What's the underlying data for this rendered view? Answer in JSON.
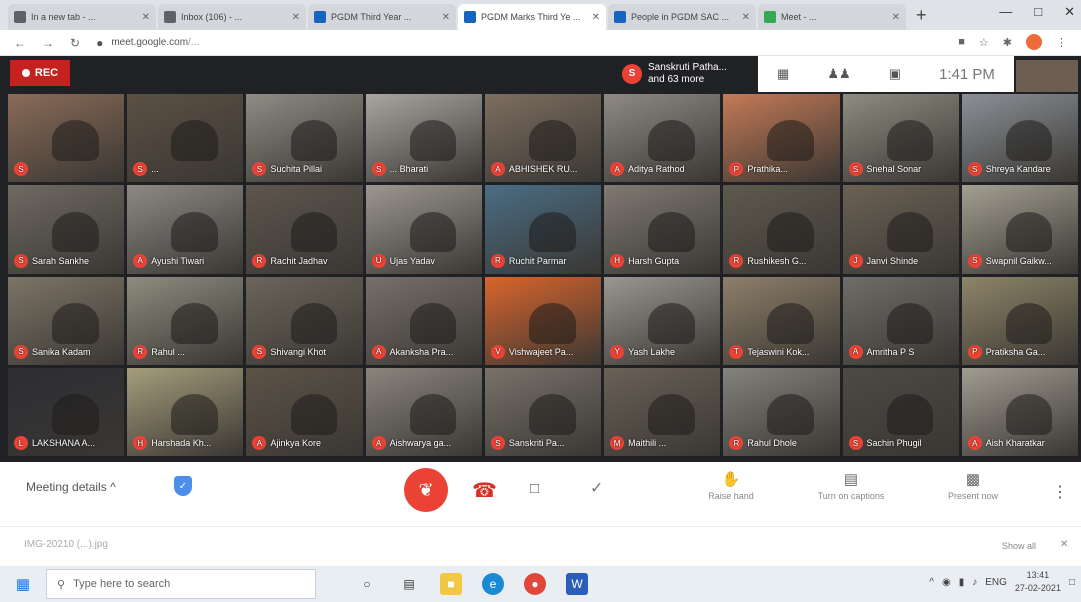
{
  "browser": {
    "tabs": [
      {
        "label": "In a new tab - ...",
        "color": "#5f6368",
        "active": false
      },
      {
        "label": "Inbox (106) - ...",
        "color": "#5f6368",
        "active": false
      },
      {
        "label": "PGDM Third Year ...",
        "color": "#1565c0",
        "active": false
      },
      {
        "label": "PGDM Marks Third Ye ...",
        "color": "#1565c0",
        "active": true
      },
      {
        "label": "People in PGDM SAC ...",
        "color": "#1565c0",
        "active": false
      },
      {
        "label": "Meet - ...",
        "color": "#34a853",
        "active": false
      }
    ],
    "new_tab": "+",
    "url": "meet.google.com",
    "url_rest": "/..."
  },
  "meet": {
    "rec_label": "REC",
    "presenter_line1": "Sanskruti Patha...",
    "presenter_line2": "and 63 more",
    "presenter_initial": "S",
    "clock": "1:41 PM",
    "participants": [
      {
        "name": "",
        "initial": "S",
        "color": "#8a6b58"
      },
      {
        "name": "...",
        "initial": "S",
        "color": "#5c5044"
      },
      {
        "name": "Suchita Pillai",
        "initial": "S",
        "color": "#8f8c84"
      },
      {
        "name": "... Bharati",
        "initial": "S",
        "color": "#a9a6a0"
      },
      {
        "name": "ABHISHEK RU...",
        "initial": "A",
        "color": "#7d6e60"
      },
      {
        "name": "Aditya Rathod",
        "initial": "A",
        "color": "#8e8a83"
      },
      {
        "name": "Prathika...",
        "initial": "P",
        "color": "#c47a56"
      },
      {
        "name": "Snehal Sonar",
        "initial": "S",
        "color": "#8e8b80"
      },
      {
        "name": "Shreya Kandare",
        "initial": "S",
        "color": "#8b9096"
      },
      {
        "name": "Sarah Sankhe",
        "initial": "S",
        "color": "#6f6a62"
      },
      {
        "name": "Ayushi Tiwari",
        "initial": "A",
        "color": "#8d8a86"
      },
      {
        "name": "Rachit Jadhav",
        "initial": "R",
        "color": "#5d564e"
      },
      {
        "name": "Ujas Yadav",
        "initial": "U",
        "color": "#9c9790"
      },
      {
        "name": "Ruchit Parmar",
        "initial": "R",
        "color": "#4a6d84"
      },
      {
        "name": "Harsh Gupta",
        "initial": "H",
        "color": "#7f7a72"
      },
      {
        "name": "Rushikesh G...",
        "initial": "R",
        "color": "#5f5a4f"
      },
      {
        "name": "Janvi Shinde",
        "initial": "J",
        "color": "#6b6255"
      },
      {
        "name": "Swapnil Gaikw...",
        "initial": "S",
        "color": "#a39f92"
      },
      {
        "name": "Sanika Kadam",
        "initial": "S",
        "color": "#7d7466"
      },
      {
        "name": "Rahul ...",
        "initial": "R",
        "color": "#8e8b7e"
      },
      {
        "name": "Shivangi Khot",
        "initial": "S",
        "color": "#6b655a"
      },
      {
        "name": "Akanksha Pra...",
        "initial": "A",
        "color": "#77706a"
      },
      {
        "name": "Vishwajeet Pa...",
        "initial": "V",
        "color": "#d9652c"
      },
      {
        "name": "Yash Lakhe",
        "initial": "Y",
        "color": "#9a9690"
      },
      {
        "name": "Tejaswini Kok...",
        "initial": "T",
        "color": "#8e7f6a"
      },
      {
        "name": "Amritha P S",
        "initial": "A",
        "color": "#6e6d67"
      },
      {
        "name": "Pratiksha Ga...",
        "initial": "P",
        "color": "#8e8468"
      },
      {
        "name": "LAKSHANA A...",
        "initial": "L",
        "color": "#2d2d33"
      },
      {
        "name": "Harshada Kh...",
        "initial": "H",
        "color": "#a59d7c"
      },
      {
        "name": "Ajinkya Kore",
        "initial": "A",
        "color": "#5c5347"
      },
      {
        "name": "Aishwarya ga...",
        "initial": "A",
        "color": "#8a857d"
      },
      {
        "name": "Sanskriti Pa...",
        "initial": "S",
        "color": "#78726a"
      },
      {
        "name": "Maithili ...",
        "initial": "M",
        "color": "#6a6157"
      },
      {
        "name": "Rahul Dhole",
        "initial": "R",
        "color": "#84827c"
      },
      {
        "name": "Sachin Phugil",
        "initial": "S",
        "color": "#4d4944"
      },
      {
        "name": "Aish Kharatkar",
        "initial": "A",
        "color": "#a19c92"
      }
    ]
  },
  "controls": {
    "meeting_details": "Meeting details",
    "caret": "^",
    "raise_hand": "Raise hand",
    "captions": "Turn on captions",
    "present": "Present now"
  },
  "downloads": {
    "file": "IMG-20210 (...).jpg",
    "show_all": "Show all"
  },
  "taskbar": {
    "search_placeholder": "Type here to search",
    "lang": "ENG",
    "time": "13:41",
    "date": "27-02-2021"
  }
}
